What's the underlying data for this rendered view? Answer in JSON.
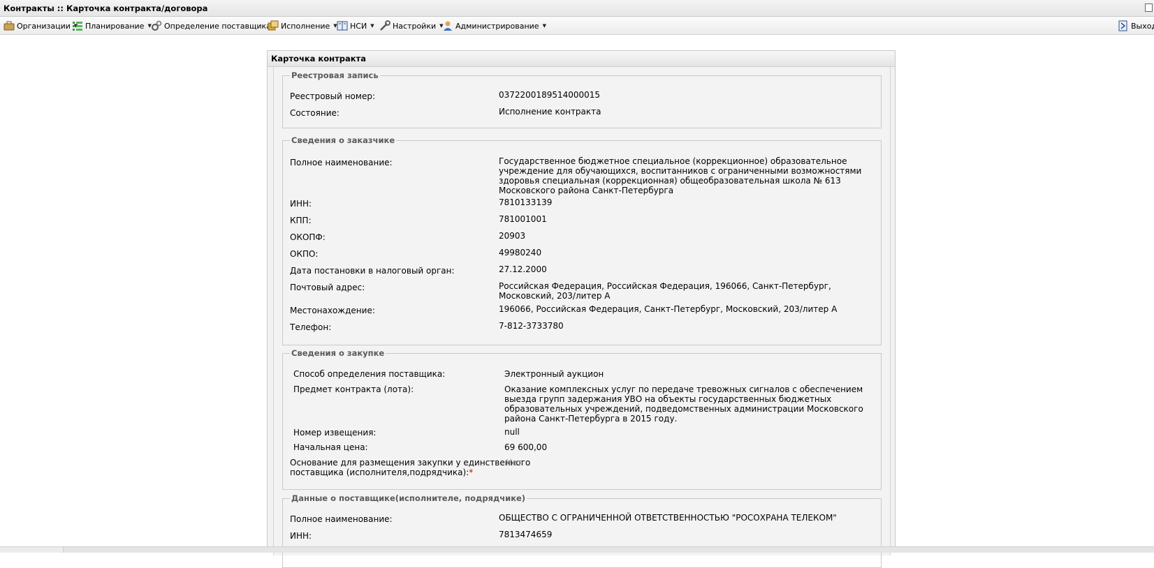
{
  "window": {
    "title": "Контракты :: Карточка контракта/договора"
  },
  "menu": {
    "items": [
      {
        "label": "Организации",
        "icon": "organizations-icon"
      },
      {
        "label": "Планирование",
        "icon": "planning-icon"
      },
      {
        "label": "Определение поставщика",
        "icon": "gears-icon"
      },
      {
        "label": "Исполнение",
        "icon": "execution-icon"
      },
      {
        "label": "НСИ",
        "icon": "book-icon"
      },
      {
        "label": "Настройки",
        "icon": "wrench-icon"
      },
      {
        "label": "Администрирование",
        "icon": "user-icon"
      }
    ],
    "exit_label": "Выход"
  },
  "card": {
    "title": "Карточка контракта",
    "registry": {
      "legend": "Реестровая запись",
      "rows": [
        {
          "label": "Реестровый номер:",
          "value": "0372200189514000015"
        },
        {
          "label": "Состояние:",
          "value": "Исполнение контракта"
        }
      ]
    },
    "customer": {
      "legend": "Сведения о заказчике",
      "rows": [
        {
          "label": "Полное наименование:",
          "value": "Государственное бюджетное специальное (коррекционное) образовательное учреждение для обучающихся, воспитанников с ограниченными возможностями здоровья специальная (коррекционная) общеобразовательная школа № 613 Московского района Санкт-Петербурга"
        },
        {
          "label": "ИНН:",
          "value": "7810133139"
        },
        {
          "label": "КПП:",
          "value": "781001001"
        },
        {
          "label": "ОКОПФ:",
          "value": "20903"
        },
        {
          "label": "ОКПО:",
          "value": "49980240"
        },
        {
          "label": "Дата постановки в налоговый орган:",
          "value": "27.12.2000"
        },
        {
          "label": "Почтовый адрес:",
          "value": "Российская Федерация, Российская Федерация, 196066, Санкт-Петербург, Московский, 203/литер А"
        },
        {
          "label": "Местонахождение:",
          "value": "196066, Российская Федерация, Санкт-Петербург, Московский, 203/литер А"
        },
        {
          "label": "Телефон:",
          "value": "7-812-3733780"
        }
      ]
    },
    "purchase": {
      "legend": "Сведения о закупке",
      "rows": [
        {
          "label": "Способ определения поставщика:",
          "value": "Электронный аукцион"
        },
        {
          "label": "Предмет контракта (лота):",
          "value": "Оказание комплексных услуг по передаче тревожных сигналов с обеспечением выезда групп задержания УВО на объекты государственных бюджетных образовательных учреждений, подведомственных администрации Московского района Санкт-Петербурга в 2015 году."
        },
        {
          "label": "Номер извещения:",
          "value": "null"
        },
        {
          "label": "Начальная цена:",
          "value": "69 600,00"
        }
      ],
      "sole_supplier": {
        "label_line1": "Основание для размещения закупки у единственного",
        "label_line2": "поставщика (исполнителя,подрядчика):",
        "required_mark": "*",
        "value": "Нет"
      }
    },
    "supplier": {
      "legend": "Данные о поставщике(исполнителе, подрядчике)",
      "rows": [
        {
          "label": "Полное наименование:",
          "value": "ОБЩЕСТВО С ОГРАНИЧЕННОЙ ОТВЕТСТВЕННОСТЬЮ \"РОСОХРАНА ТЕЛЕКОМ\""
        },
        {
          "label": "ИНН:",
          "value": "7813474659"
        }
      ]
    }
  }
}
